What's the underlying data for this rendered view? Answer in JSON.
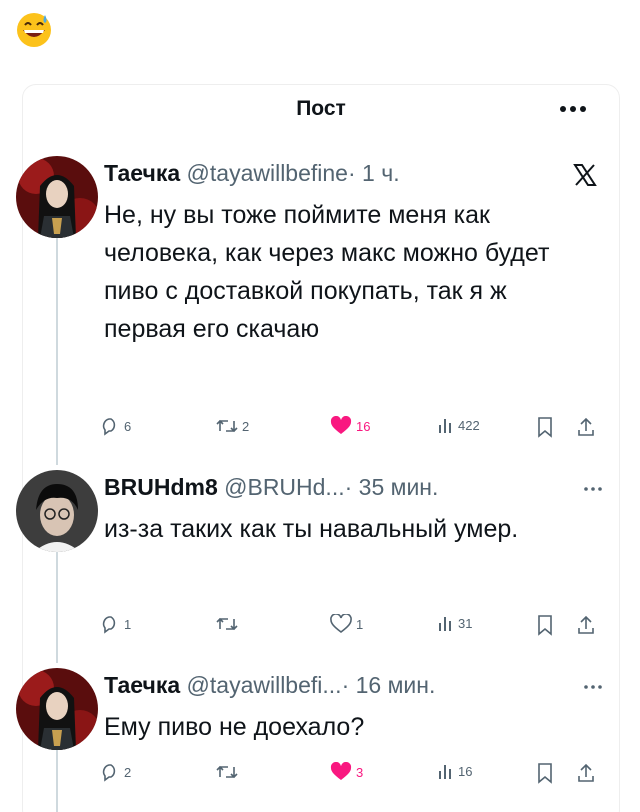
{
  "header": {
    "title": "Пост"
  },
  "tweets": [
    {
      "name": "Таечка",
      "handle": "@tayawillbefine",
      "time": "· 1 ч.",
      "text": "Не, ну вы тоже поймите меня как человека, как через макс можно будет пиво с доставкой покупать, так  я ж первая его скачаю",
      "replies": "6",
      "retweets": "2",
      "likes": "16",
      "views": "422"
    },
    {
      "name": "BRUHdm8",
      "handle": "@BRUHd...",
      "time": "· 35 мин.",
      "text": "из-за таких как ты навальный умер.",
      "replies": "1",
      "retweets": "",
      "likes": "1",
      "views": "31"
    },
    {
      "name": "Таечка",
      "handle": "@tayawillbefi...",
      "time": "· 16 мин.",
      "text": "Ему пиво не доехало?",
      "replies": "2",
      "retweets": "",
      "likes": "3",
      "views": "16"
    }
  ],
  "colors": {
    "like": "#f91880",
    "muted": "#536471",
    "line": "#cfd9de"
  }
}
